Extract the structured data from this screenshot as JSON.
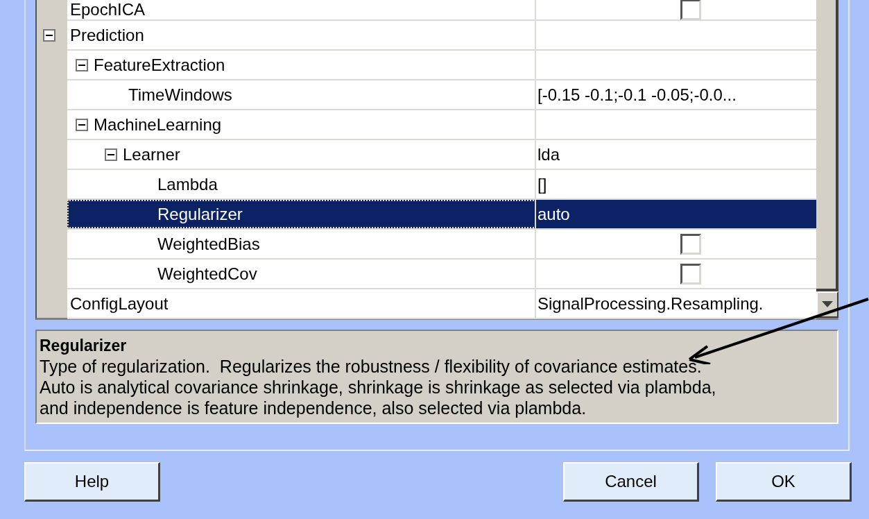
{
  "properties": [
    {
      "name": "EpochICA",
      "kind": "checkbox",
      "checked": false
    },
    {
      "name": "Prediction",
      "kind": "group",
      "expanded": true,
      "children": [
        {
          "name": "FeatureExtraction",
          "kind": "group",
          "expanded": true,
          "children": [
            {
              "name": "TimeWindows",
              "kind": "text",
              "value": "[-0.15 -0.1;-0.1 -0.05;-0.0...",
              "selected": false
            }
          ]
        },
        {
          "name": "MachineLearning",
          "kind": "group",
          "expanded": true,
          "children": [
            {
              "name": "Learner",
              "kind": "group",
              "expanded": true,
              "value": "lda",
              "children": [
                {
                  "name": "Lambda",
                  "kind": "text",
                  "value": "[]",
                  "selected": false
                },
                {
                  "name": "Regularizer",
                  "kind": "text",
                  "value": "auto",
                  "selected": true
                },
                {
                  "name": "WeightedBias",
                  "kind": "checkbox",
                  "checked": false
                },
                {
                  "name": "WeightedCov",
                  "kind": "checkbox",
                  "checked": false
                }
              ]
            }
          ]
        }
      ]
    },
    {
      "name": "ConfigLayout",
      "kind": "text",
      "value": "SignalProcessing.Resampling.",
      "selected": false
    }
  ],
  "description": {
    "title": "Regularizer",
    "text": "Type of regularization.  Regularizes the robustness / flexibility of covariance estimates. Auto is analytical covariance shrinkage, shrinkage is shrinkage as selected via plambda, and independence is feature independence, also selected via plambda."
  },
  "buttons": [
    {
      "label": "Help",
      "kind": "help"
    },
    {
      "label": "Cancel",
      "kind": "cancel"
    },
    {
      "label": "OK",
      "kind": "ok"
    }
  ]
}
